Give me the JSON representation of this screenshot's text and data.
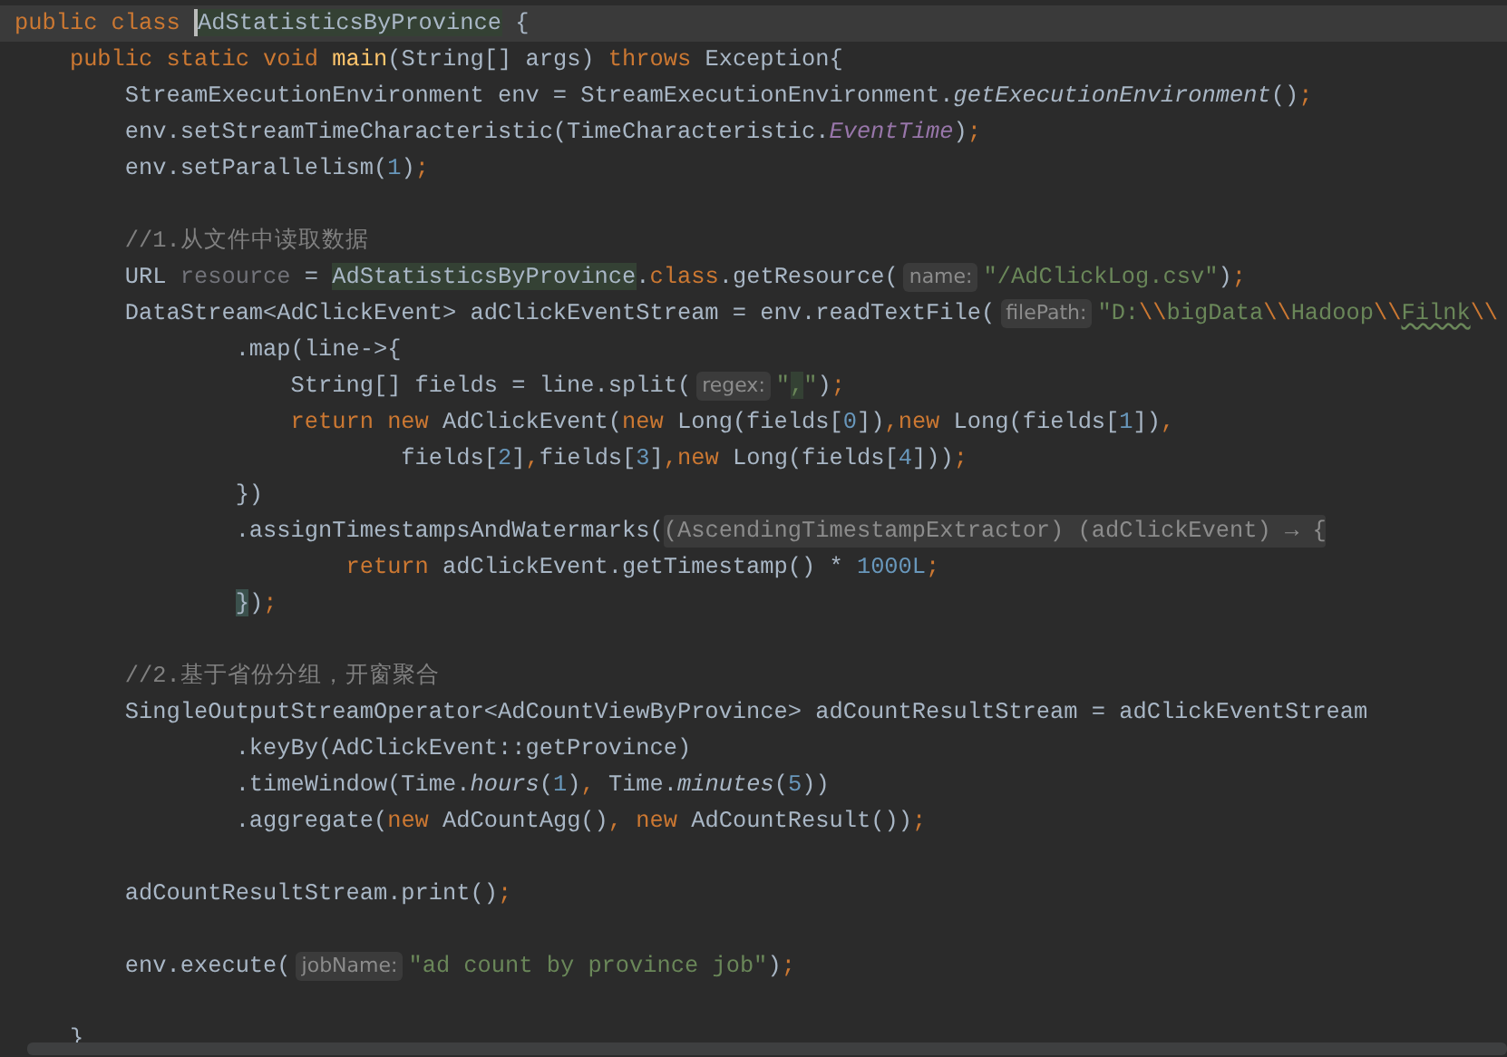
{
  "editor": {
    "lines": [
      {
        "current": true,
        "tokens": [
          {
            "kind": "kw",
            "t": "public class "
          },
          {
            "kind": "hl",
            "t": "AdStatisticsByProvince"
          },
          {
            "kind": "p",
            "t": " {"
          }
        ]
      },
      {
        "current": false,
        "tokens": [
          {
            "kind": "kw",
            "t": "    public static void "
          },
          {
            "kind": "m",
            "t": "main"
          },
          {
            "kind": "p",
            "t": "(String[] args) "
          },
          {
            "kind": "kw",
            "t": "throws "
          },
          {
            "kind": "p",
            "t": "Exception{"
          }
        ]
      },
      {
        "current": false,
        "tokens": [
          {
            "kind": "p",
            "t": "        StreamExecutionEnvironment env = StreamExecutionEnvironment."
          },
          {
            "kind": "it",
            "t": "getExecutionEnvironment"
          },
          {
            "kind": "p",
            "t": "()"
          },
          {
            "kind": "kw",
            "t": ";"
          }
        ]
      },
      {
        "current": false,
        "tokens": [
          {
            "kind": "p",
            "t": "        env.setStreamTimeCharacteristic(TimeCharacteristic."
          },
          {
            "kind": "st",
            "t": "EventTime"
          },
          {
            "kind": "p",
            "t": ")"
          },
          {
            "kind": "kw",
            "t": ";"
          }
        ]
      },
      {
        "current": false,
        "tokens": [
          {
            "kind": "p",
            "t": "        env.setParallelism("
          },
          {
            "kind": "n",
            "t": "1"
          },
          {
            "kind": "p",
            "t": ")"
          },
          {
            "kind": "kw",
            "t": ";"
          }
        ]
      },
      {
        "current": false
      },
      {
        "current": false,
        "tokens": [
          {
            "kind": "c",
            "t": "        //1.从文件中读取数据"
          }
        ]
      },
      {
        "current": false,
        "tokens": [
          {
            "kind": "p",
            "t": "        URL "
          },
          {
            "kind": "u",
            "t": "resource"
          },
          {
            "kind": "p",
            "t": " = "
          },
          {
            "kind": "hl",
            "t": "AdStatisticsByProvince"
          },
          {
            "kind": "p",
            "t": "."
          },
          {
            "kind": "kw",
            "t": "class"
          },
          {
            "kind": "p",
            "t": ".getResource("
          },
          {
            "kind": "hint",
            "t": "name:"
          },
          {
            "kind": "s",
            "t": "\"/AdClickLog.csv\""
          },
          {
            "kind": "p",
            "t": ")"
          },
          {
            "kind": "kw",
            "t": ";"
          }
        ]
      },
      {
        "current": false,
        "tokens": [
          {
            "kind": "p",
            "t": "        DataStream<AdClickEvent> adClickEventStream = env.readTextFile("
          },
          {
            "kind": "hint",
            "t": "filePath:"
          },
          {
            "kind": "s",
            "t": "\"D:"
          },
          {
            "kind": "kw",
            "t": "\\\\"
          },
          {
            "kind": "s",
            "t": "bigData"
          },
          {
            "kind": "kw",
            "t": "\\\\"
          },
          {
            "kind": "s",
            "t": "Hadoop"
          },
          {
            "kind": "kw",
            "t": "\\\\"
          },
          {
            "kind": "typo",
            "t": "Filnk"
          },
          {
            "kind": "kw",
            "t": "\\\\"
          }
        ]
      },
      {
        "current": false,
        "tokens": [
          {
            "kind": "p",
            "t": "                .map(line->{"
          }
        ]
      },
      {
        "current": false,
        "tokens": [
          {
            "kind": "p",
            "t": "                    String[] fields = line.split("
          },
          {
            "kind": "hint",
            "t": "regex:"
          },
          {
            "kind": "s",
            "t": "\""
          },
          {
            "kind": "hs",
            "t": ","
          },
          {
            "kind": "s",
            "t": "\""
          },
          {
            "kind": "p",
            "t": ")"
          },
          {
            "kind": "kw",
            "t": ";"
          }
        ]
      },
      {
        "current": false,
        "tokens": [
          {
            "kind": "kw",
            "t": "                    return new "
          },
          {
            "kind": "p",
            "t": "AdClickEvent("
          },
          {
            "kind": "kw",
            "t": "new "
          },
          {
            "kind": "p",
            "t": "Long(fields["
          },
          {
            "kind": "n",
            "t": "0"
          },
          {
            "kind": "p",
            "t": "])"
          },
          {
            "kind": "kw",
            "t": ",new "
          },
          {
            "kind": "p",
            "t": "Long(fields["
          },
          {
            "kind": "n",
            "t": "1"
          },
          {
            "kind": "p",
            "t": "])"
          },
          {
            "kind": "kw",
            "t": ","
          }
        ]
      },
      {
        "current": false,
        "tokens": [
          {
            "kind": "p",
            "t": "                            fields["
          },
          {
            "kind": "n",
            "t": "2"
          },
          {
            "kind": "p",
            "t": "]"
          },
          {
            "kind": "kw",
            "t": ","
          },
          {
            "kind": "p",
            "t": "fields["
          },
          {
            "kind": "n",
            "t": "3"
          },
          {
            "kind": "p",
            "t": "]"
          },
          {
            "kind": "kw",
            "t": ",new "
          },
          {
            "kind": "p",
            "t": "Long(fields["
          },
          {
            "kind": "n",
            "t": "4"
          },
          {
            "kind": "p",
            "t": "]))"
          },
          {
            "kind": "kw",
            "t": ";"
          }
        ]
      },
      {
        "current": false,
        "tokens": [
          {
            "kind": "p",
            "t": "                })"
          }
        ]
      },
      {
        "current": false,
        "tokens": [
          {
            "kind": "p",
            "t": "                .assignTimestampsAndWatermarks("
          },
          {
            "kind": "fold",
            "t": "(AscendingTimestampExtractor) (adClickEvent) → {"
          }
        ]
      },
      {
        "current": false,
        "tokens": [
          {
            "kind": "kw",
            "t": "                        return "
          },
          {
            "kind": "p",
            "t": "adClickEvent.getTimestamp() * "
          },
          {
            "kind": "n",
            "t": "1000L"
          },
          {
            "kind": "kw",
            "t": ";"
          }
        ]
      },
      {
        "current": false,
        "tokens": [
          {
            "kind": "b",
            "t": "                }"
          },
          {
            "kind": "p",
            "t": ")"
          },
          {
            "kind": "kw",
            "t": ";"
          }
        ]
      },
      {
        "current": false
      },
      {
        "current": false,
        "tokens": [
          {
            "kind": "c",
            "t": "        //2.基于省份分组，开窗聚合"
          }
        ]
      },
      {
        "current": false,
        "tokens": [
          {
            "kind": "p",
            "t": "        SingleOutputStreamOperator<AdCountViewByProvince> adCountResultStream = adClickEventStream"
          }
        ]
      },
      {
        "current": false,
        "tokens": [
          {
            "kind": "p",
            "t": "                .keyBy(AdClickEvent::getProvince)"
          }
        ]
      },
      {
        "current": false,
        "tokens": [
          {
            "kind": "p",
            "t": "                .timeWindow(Time."
          },
          {
            "kind": "it",
            "t": "hours"
          },
          {
            "kind": "p",
            "t": "("
          },
          {
            "kind": "n",
            "t": "1"
          },
          {
            "kind": "p",
            "t": ")"
          },
          {
            "kind": "kw",
            "t": ","
          },
          {
            "kind": "p",
            "t": " Time."
          },
          {
            "kind": "it",
            "t": "minutes"
          },
          {
            "kind": "p",
            "t": "("
          },
          {
            "kind": "n",
            "t": "5"
          },
          {
            "kind": "p",
            "t": "))"
          }
        ]
      },
      {
        "current": false,
        "tokens": [
          {
            "kind": "p",
            "t": "                .aggregate("
          },
          {
            "kind": "kw",
            "t": "new "
          },
          {
            "kind": "p",
            "t": "AdCountAgg()"
          },
          {
            "kind": "kw",
            "t": ", new "
          },
          {
            "kind": "p",
            "t": "AdCountResult())"
          },
          {
            "kind": "kw",
            "t": ";"
          }
        ]
      },
      {
        "current": false
      },
      {
        "current": false,
        "tokens": [
          {
            "kind": "p",
            "t": "        adCountResultStream.print()"
          },
          {
            "kind": "kw",
            "t": ";"
          }
        ]
      },
      {
        "current": false
      },
      {
        "current": false,
        "tokens": [
          {
            "kind": "p",
            "t": "        env.execute("
          },
          {
            "kind": "hint",
            "t": "jobName:"
          },
          {
            "kind": "s",
            "t": "\"ad count by province job\""
          },
          {
            "kind": "p",
            "t": ")"
          },
          {
            "kind": "kw",
            "t": ";"
          }
        ]
      },
      {
        "current": false
      },
      {
        "current": false,
        "tokens": [
          {
            "kind": "p",
            "t": "    }"
          }
        ]
      }
    ]
  }
}
